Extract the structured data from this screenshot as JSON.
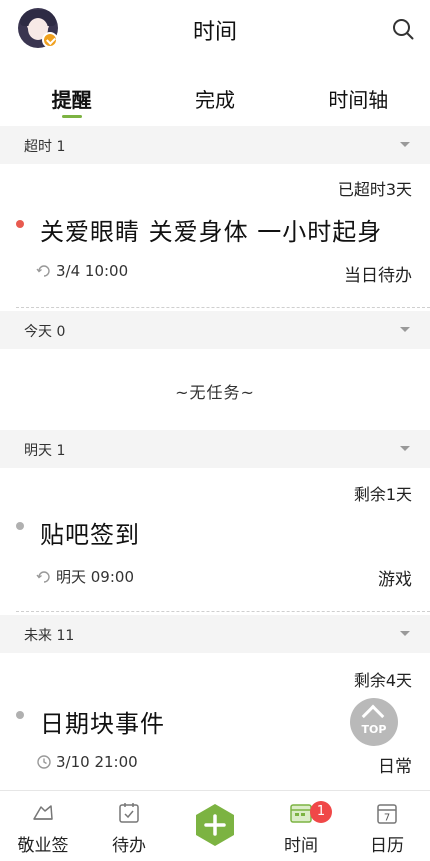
{
  "header": {
    "title": "时间",
    "avatar_icon": "avatar-girl"
  },
  "tabs": [
    {
      "label": "提醒",
      "active": true
    },
    {
      "label": "完成",
      "active": false
    },
    {
      "label": "时间轴",
      "active": false
    }
  ],
  "groups": [
    {
      "label": "超时 1",
      "tasks": [
        {
          "status": "已超时3天",
          "title": "关爱眼睛 关爱身体 一小时起身",
          "time": "3/4 10:00",
          "category": "当日待办",
          "dot_color": "#e85a4f"
        }
      ]
    },
    {
      "label": "今天 0",
      "empty_text": "~无任务~"
    },
    {
      "label": "明天 1",
      "tasks": [
        {
          "status": "剩余1天",
          "title": "贴吧签到",
          "time": "明天 09:00",
          "category": "游戏",
          "dot_color": "#b0b0b0"
        }
      ]
    },
    {
      "label": "未来 11",
      "tasks": [
        {
          "status": "剩余4天",
          "title": "日期块事件",
          "time": "3/10 21:00",
          "category": "日常",
          "dot_color": "#b0b0b0"
        }
      ]
    }
  ],
  "top_button": {
    "label": "TOP"
  },
  "bottom_nav": [
    {
      "label": "敬业签"
    },
    {
      "label": "待办"
    },
    {
      "label": ""
    },
    {
      "label": "时间",
      "badge": "1"
    },
    {
      "label": "日历",
      "calendar_day": "7"
    }
  ],
  "colors": {
    "accent": "#7cb342",
    "overdue": "#e85a4f",
    "badge": "#f04848"
  }
}
